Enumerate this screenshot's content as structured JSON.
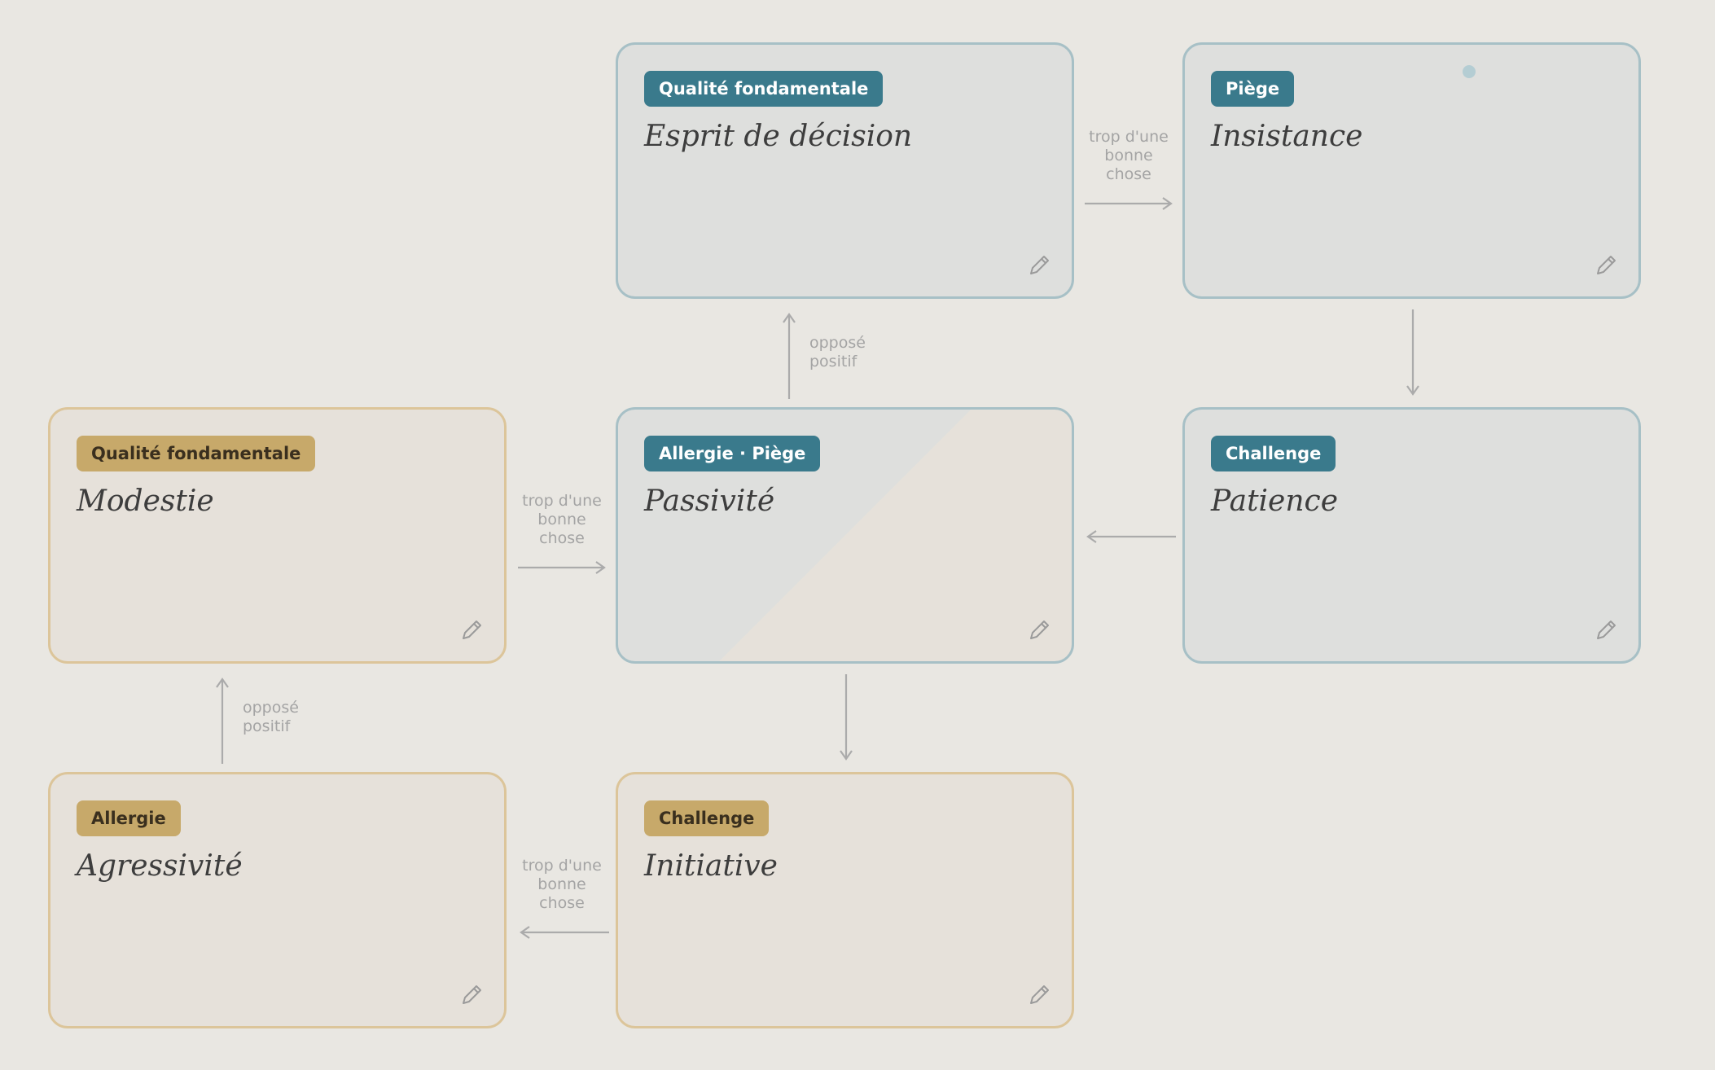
{
  "cards": {
    "esprit": {
      "badge": "Qualité fondamentale",
      "title": "Esprit de décision"
    },
    "insistance": {
      "badge": "Piège",
      "title": "Insistance"
    },
    "modestie": {
      "badge": "Qualité fondamentale",
      "title": "Modestie"
    },
    "passivite": {
      "badge": "Allergie · Piège",
      "title": "Passivité"
    },
    "patience": {
      "badge": "Challenge",
      "title": "Patience"
    },
    "agressivite": {
      "badge": "Allergie",
      "title": "Agressivité"
    },
    "initiative": {
      "badge": "Challenge",
      "title": "Initiative"
    }
  },
  "connectors": {
    "too_much_1": "trop d'une",
    "too_much_2": "bonne",
    "too_much_3": "chose",
    "opposite_1": "opposé",
    "opposite_2": "positif"
  },
  "icons": {
    "edit": "pencil-icon"
  },
  "colors": {
    "background": "#e9e7e2",
    "blue_badge": "#3a7a8c",
    "gold_badge": "#c7a96a",
    "blue_border": "#a7c0c6",
    "gold_border": "#dcc59a"
  }
}
